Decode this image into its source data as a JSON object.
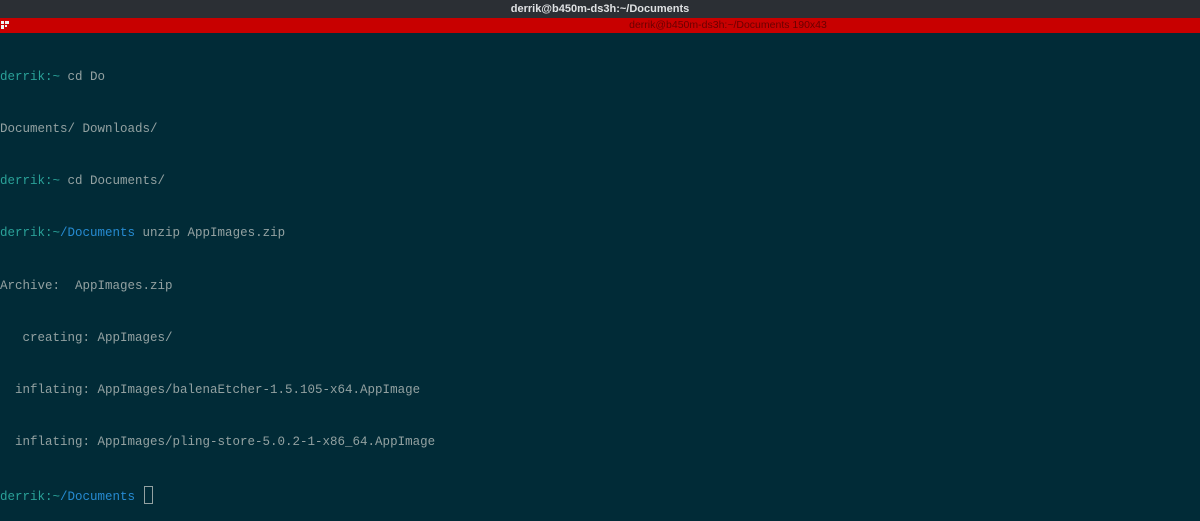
{
  "window": {
    "title": "derrik@b450m-ds3h:~/Documents"
  },
  "tab": {
    "title": "derrik@b450m-ds3h:~/Documents 190x43"
  },
  "colors": {
    "background": "#012b37",
    "prompt": "#2aa198",
    "path": "#268bd2",
    "text": "#93a1a1",
    "tabbar": "#c80000"
  },
  "terminal": {
    "lines": [
      {
        "user": "derrik:",
        "path": "~",
        "text": " cd Do"
      },
      {
        "text": "Documents/ Downloads/"
      },
      {
        "user": "derrik:",
        "path": "~",
        "text": " cd Documents/"
      },
      {
        "user": "derrik:",
        "path": "~/Documents",
        "text": " unzip AppImages.zip"
      },
      {
        "text": "Archive:  AppImages.zip"
      },
      {
        "text": "   creating: AppImages/"
      },
      {
        "text": "  inflating: AppImages/balenaEtcher-1.5.105-x64.AppImage"
      },
      {
        "text": "  inflating: AppImages/pling-store-5.0.2-1-x86_64.AppImage"
      },
      {
        "user": "derrik:",
        "path": "~/Documents",
        "text": " "
      }
    ]
  }
}
